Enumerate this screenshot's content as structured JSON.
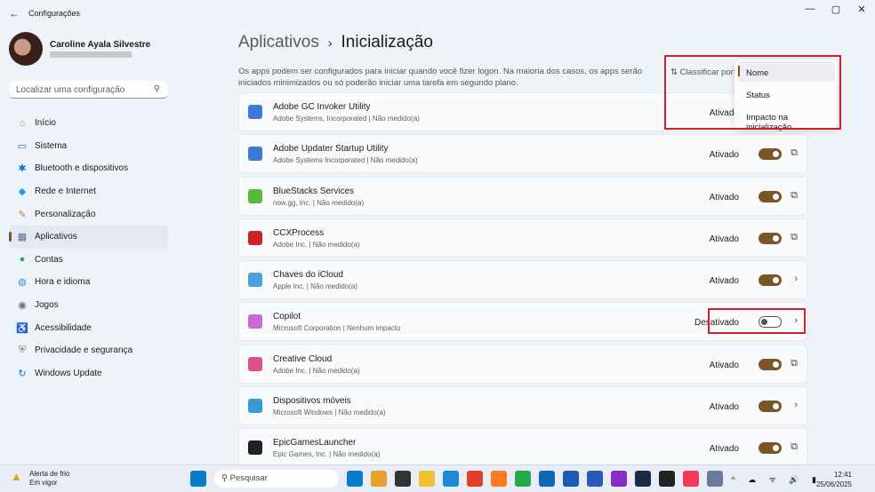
{
  "window": {
    "title": "Configurações",
    "back": "←",
    "min": "—",
    "max": "▢",
    "close": "✕"
  },
  "profile": {
    "name": "Caroline Ayala Silvestre"
  },
  "search": {
    "placeholder": "Localizar uma configuração",
    "icon": "search-icon"
  },
  "nav": [
    {
      "label": "Início",
      "icon": "⌂",
      "color": "#d08a3a"
    },
    {
      "label": "Sistema",
      "icon": "▭",
      "color": "#0a7acc"
    },
    {
      "label": "Bluetooth e dispositivos",
      "icon": "✱",
      "color": "#0a7acc"
    },
    {
      "label": "Rede e Internet",
      "icon": "◆",
      "color": "#3a8fd8"
    },
    {
      "label": "Personalização",
      "icon": "✎",
      "color": "#c87a3a"
    },
    {
      "label": "Aplicativos",
      "icon": "▦",
      "color": "#5a6a8a",
      "active": true
    },
    {
      "label": "Contas",
      "icon": "●",
      "color": "#2aa86a"
    },
    {
      "label": "Hora e idioma",
      "icon": "◍",
      "color": "#3a8fd8"
    },
    {
      "label": "Jogos",
      "icon": "◉",
      "color": "#6a6a7a"
    },
    {
      "label": "Acessibilidade",
      "icon": "♿",
      "color": "#2a6ad8"
    },
    {
      "label": "Privacidade e segurança",
      "icon": "⛨",
      "color": "#6a7a8a"
    },
    {
      "label": "Windows Update",
      "icon": "↻",
      "color": "#0a7acc"
    }
  ],
  "header": {
    "crumb_parent": "Aplicativos",
    "crumb_sep": "›",
    "title": "Inicialização",
    "description": "Os apps podem ser configurados para iniciar quando você fizer logon. Na maioria dos casos, os apps serão iniciados minimizados ou só poderão iniciar uma tarefa em segundo plano.",
    "sort_label": "⇅ Classificar por:"
  },
  "sort_options": [
    {
      "label": "Nome",
      "selected": true
    },
    {
      "label": "Status"
    },
    {
      "label": "Impacto na inicialização"
    }
  ],
  "apps": [
    {
      "name": "Adobe GC Invoker Utility",
      "sub": "Adobe Systems, Incorporated  |  Não medido(a)",
      "state": "Ativado",
      "on": true,
      "action": "⧉",
      "color": "#3a7ad8"
    },
    {
      "name": "Adobe Updater Startup Utility",
      "sub": "Adobe Systems Incorporated  |  Não medido(a)",
      "state": "Ativado",
      "on": true,
      "action": "⧉",
      "color": "#3a7ad8"
    },
    {
      "name": "BlueStacks Services",
      "sub": "now.gg, Inc.  |  Não medido(a)",
      "state": "Ativado",
      "on": true,
      "action": "⧉",
      "color": "#5ab83a"
    },
    {
      "name": "CCXProcess",
      "sub": "Adobe Inc.  |  Não medido(a)",
      "state": "Ativado",
      "on": true,
      "action": "⧉",
      "color": "#d0202a"
    },
    {
      "name": "Chaves do iCloud",
      "sub": "Apple Inc.  |  Não medido(a)",
      "state": "Ativado",
      "on": true,
      "action": "›",
      "color": "#4aa0e0"
    },
    {
      "name": "Copilot",
      "sub": "Microsoft Corporation  |  Nenhum impacto",
      "state": "Desativado",
      "on": false,
      "action": "›",
      "color": "#c86ad8"
    },
    {
      "name": "Creative Cloud",
      "sub": "Adobe Inc.  |  Não medido(a)",
      "state": "Ativado",
      "on": true,
      "action": "⧉",
      "color": "#e0508a"
    },
    {
      "name": "Dispositivos móveis",
      "sub": "Microsoft Windows  |  Não medido(a)",
      "state": "Ativado",
      "on": true,
      "action": "›",
      "color": "#3a9ad8"
    },
    {
      "name": "EpicGamesLauncher",
      "sub": "Epic Games, Inc.  |  Não medido(a)",
      "state": "Ativado",
      "on": true,
      "action": "⧉",
      "color": "#222222"
    }
  ],
  "taskbar": {
    "weather_title": "Alerta de frio",
    "weather_sub": "Em vigor",
    "search": "Pesquisar",
    "time": "12:41",
    "date": "25/06/2025",
    "apps": [
      "#0a7acc",
      "#e8a030",
      "#333333",
      "#f0c030",
      "#1a8ad8",
      "#e0402a",
      "#ff7a20",
      "#25a846",
      "#0a6ab8",
      "#1a5ab8",
      "#2a5ab8",
      "#8a2ac8",
      "#1a2a4a",
      "#222222",
      "#f03a5a",
      "#6a7a9a"
    ]
  }
}
